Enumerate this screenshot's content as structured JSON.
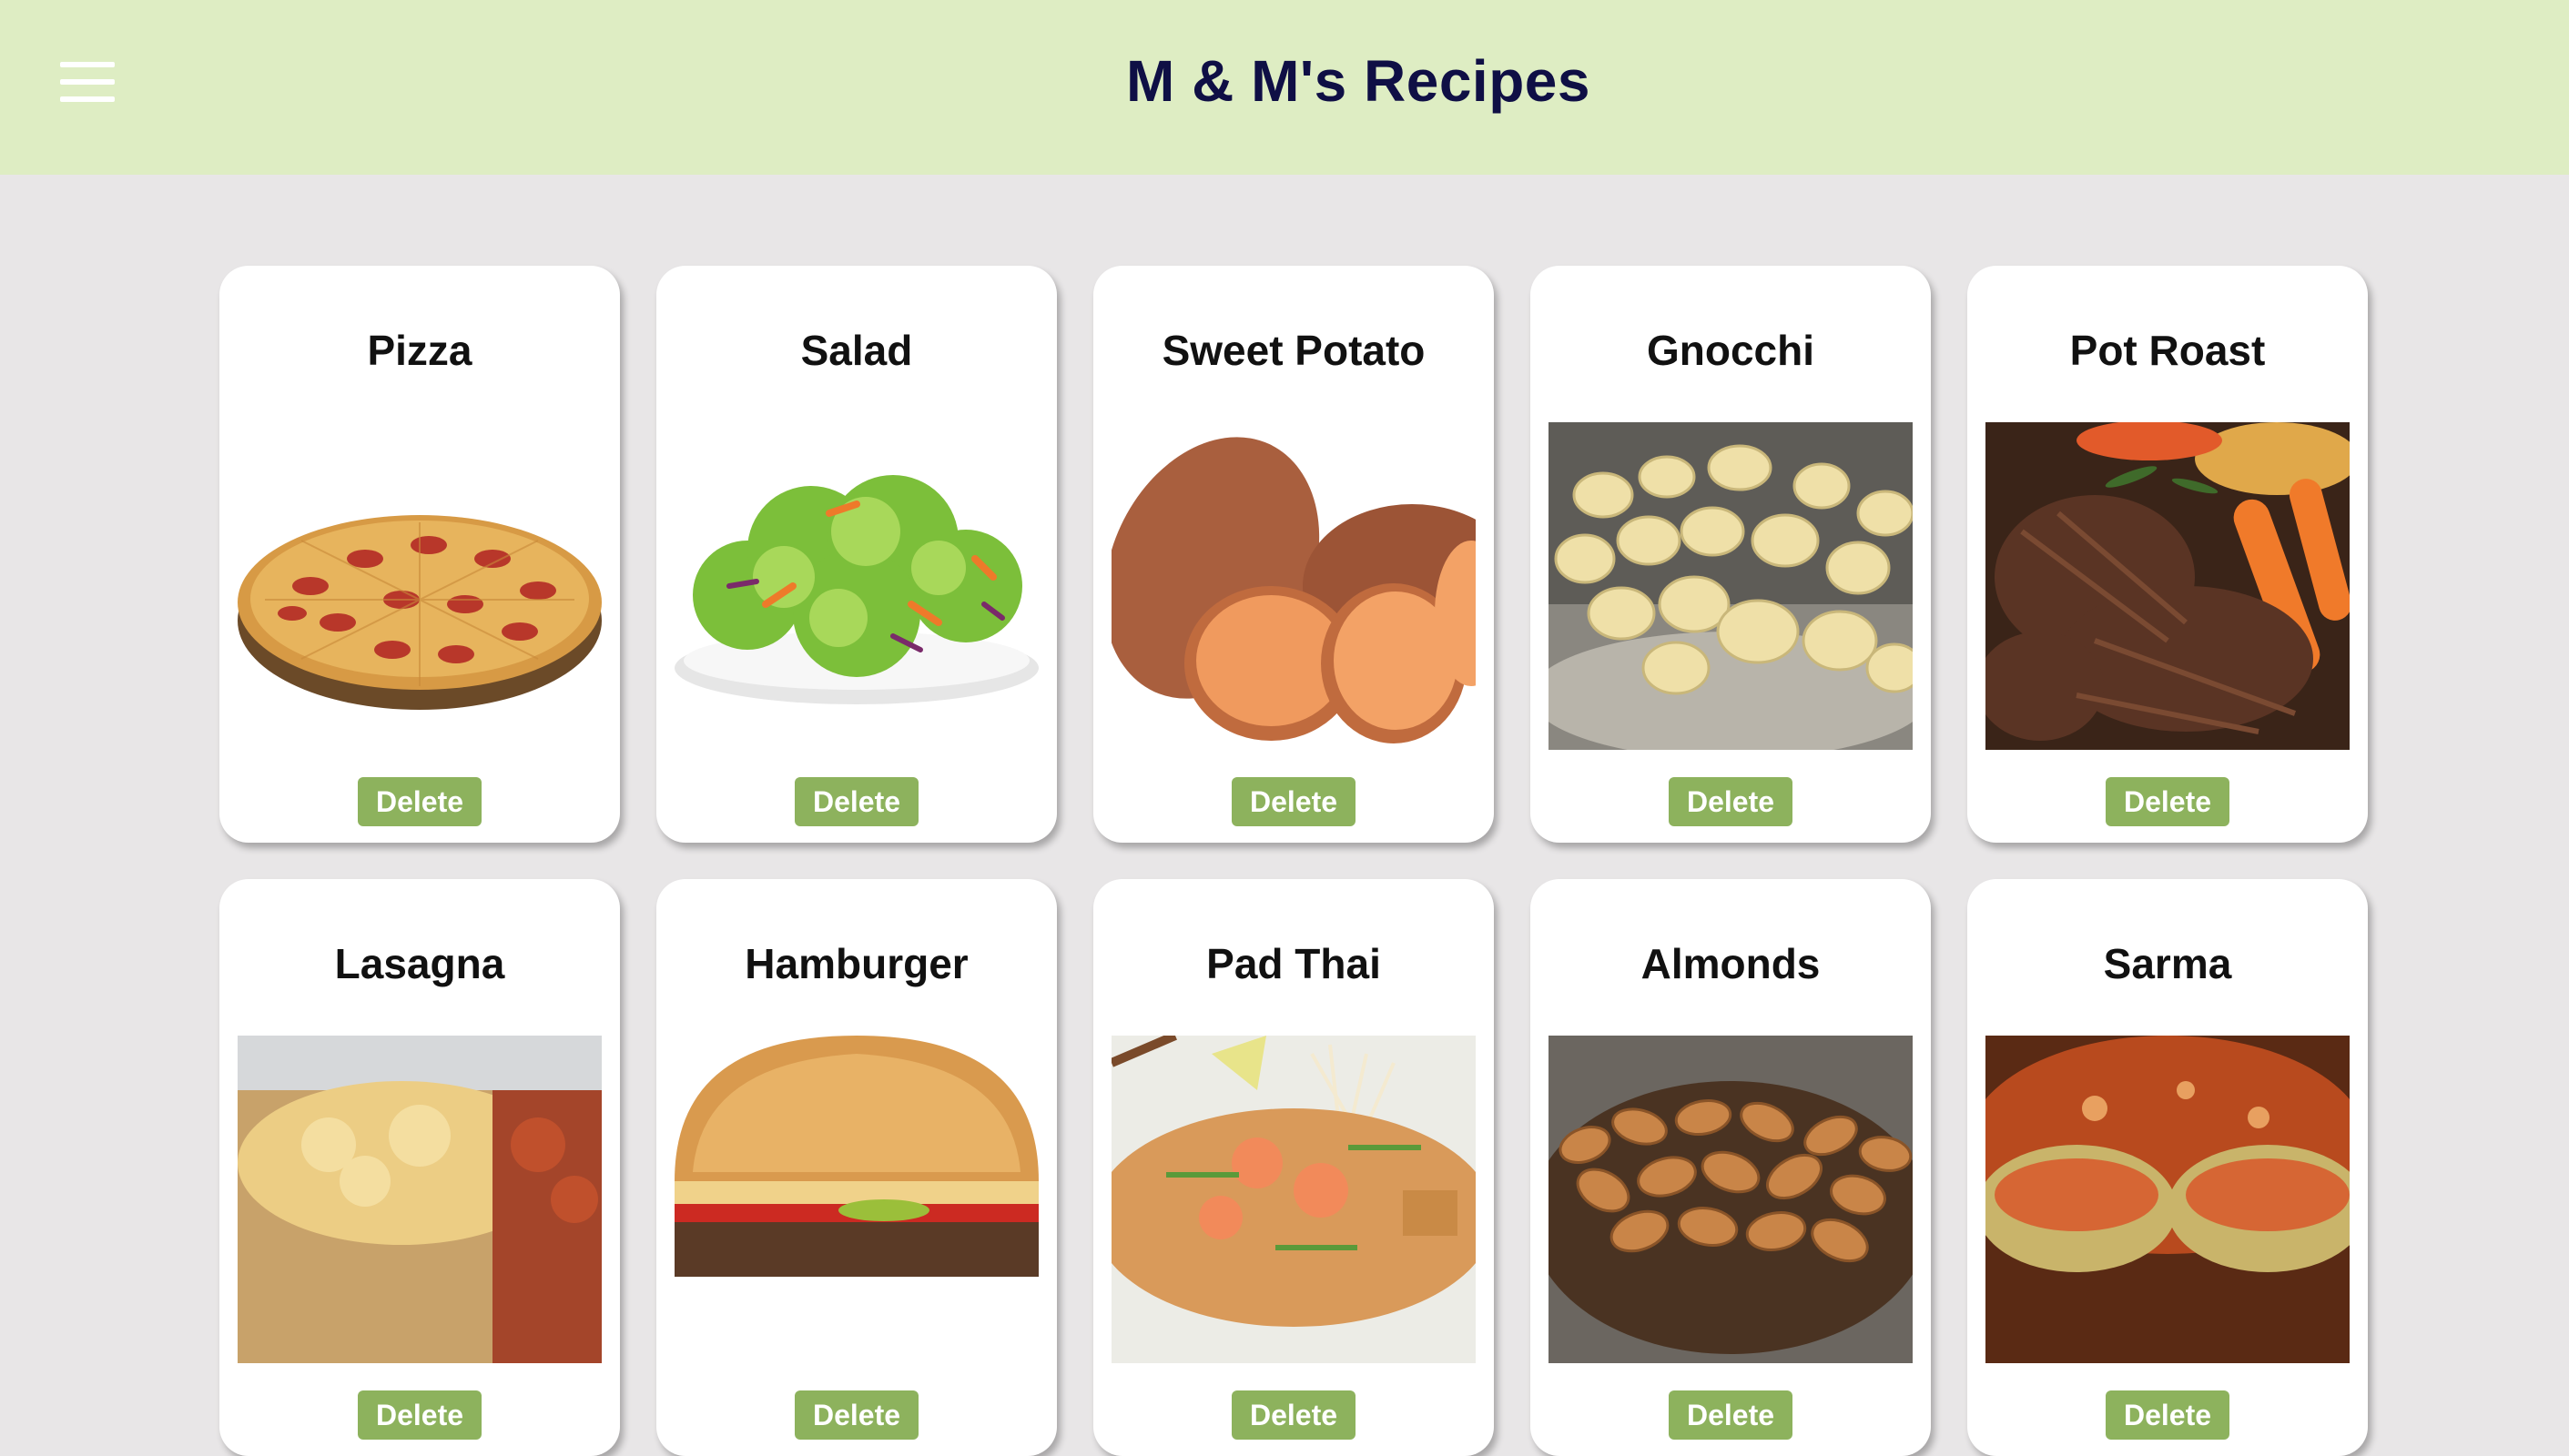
{
  "header": {
    "title": "M & M's Recipes",
    "menu_icon": "hamburger-menu-icon",
    "background": "#deedc3",
    "title_color": "#0f0f45"
  },
  "page": {
    "background": "#e8e6e7"
  },
  "recipes": [
    {
      "name": "Pizza",
      "delete_label": "Delete"
    },
    {
      "name": "Salad",
      "delete_label": "Delete"
    },
    {
      "name": "Sweet Potato",
      "delete_label": "Delete"
    },
    {
      "name": "Gnocchi",
      "delete_label": "Delete"
    },
    {
      "name": "Pot Roast",
      "delete_label": "Delete"
    },
    {
      "name": "Lasagna",
      "delete_label": "Delete"
    },
    {
      "name": "Hamburger",
      "delete_label": "Delete"
    },
    {
      "name": "Pad Thai",
      "delete_label": "Delete"
    },
    {
      "name": "Almonds",
      "delete_label": "Delete"
    },
    {
      "name": "Sarma",
      "delete_label": "Delete"
    }
  ],
  "button_color": "#8db25d"
}
